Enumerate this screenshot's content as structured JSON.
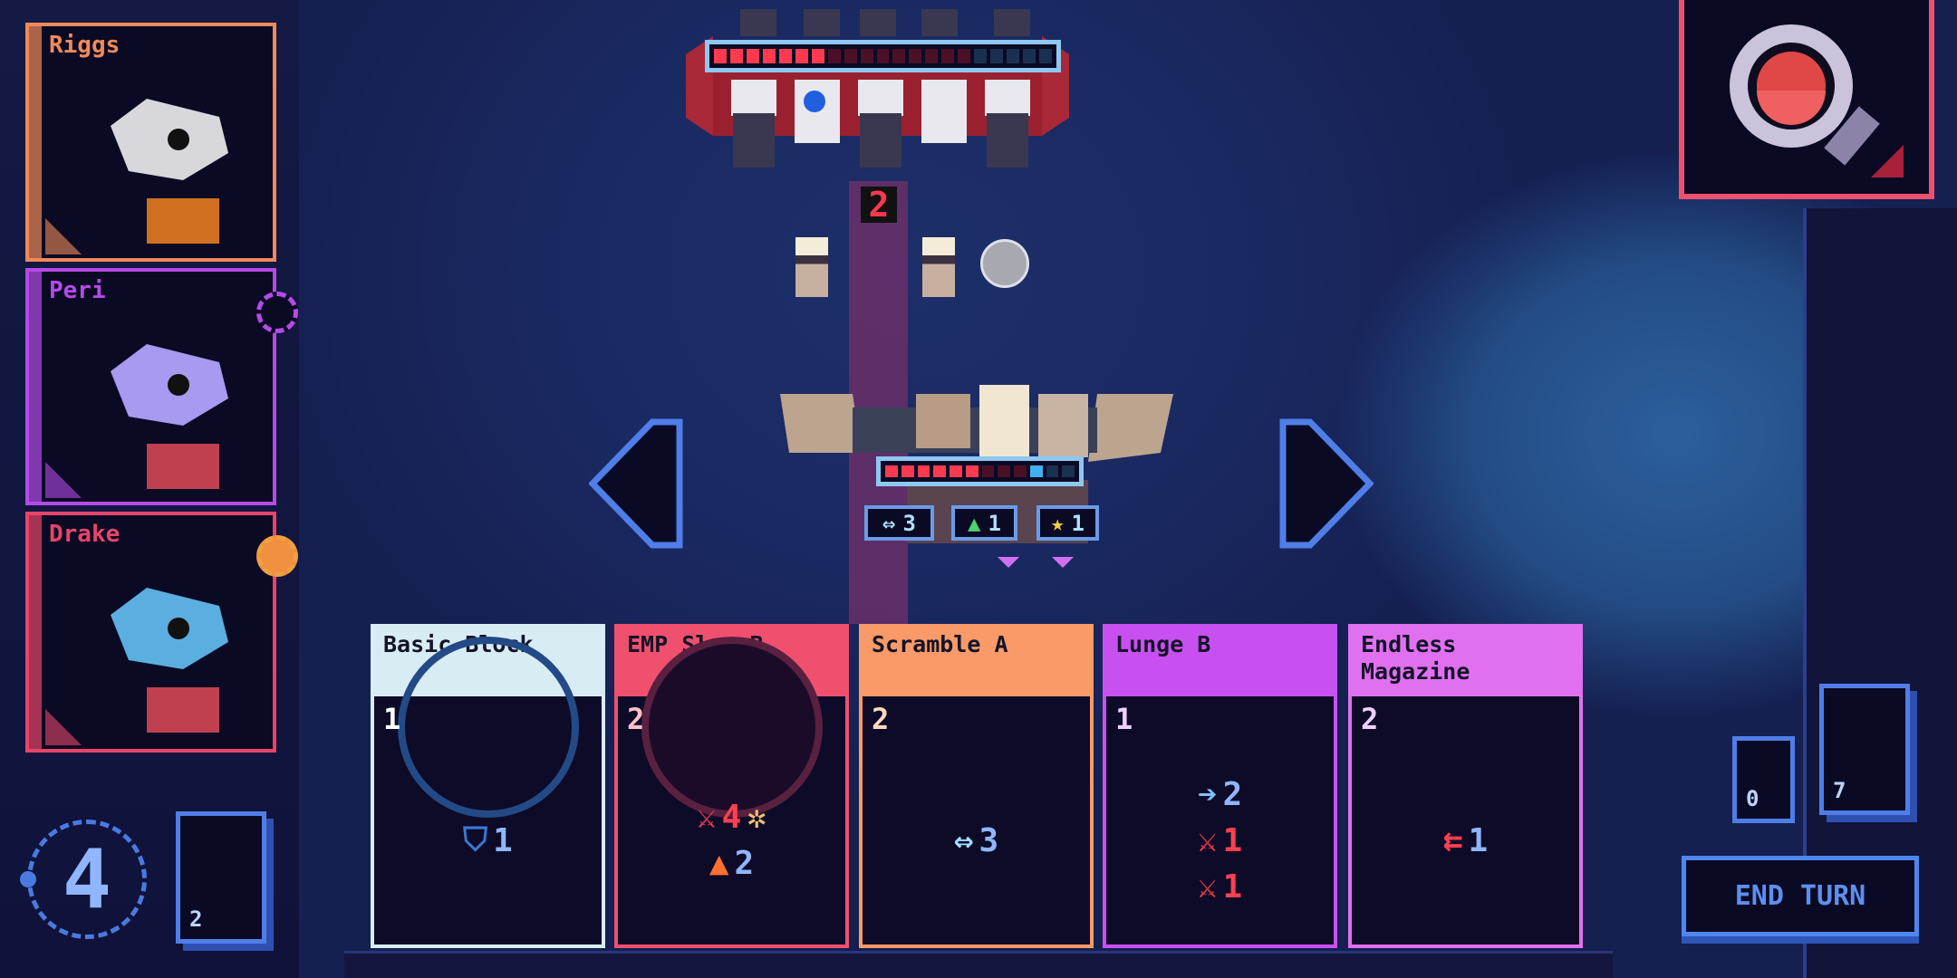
{
  "crew": [
    {
      "name": "Riggs",
      "color": "#f08a5a",
      "status_icon": "none"
    },
    {
      "name": "Peri",
      "color": "#b44ae8",
      "status_icon": "timer-icon"
    },
    {
      "name": "Drake",
      "color": "#e8446a",
      "status_icon": "battery-icon"
    }
  ],
  "energy": "4",
  "draw_pile": {
    "count": "2"
  },
  "discard_pile": {
    "count": "0"
  },
  "exhaust_pile": {
    "count": "7"
  },
  "end_turn_label": "END TURN",
  "enemy": {
    "hull_filled": 7,
    "hull_max": 16,
    "shield_max": 5,
    "shield_filled": 0,
    "intent_damage": "2",
    "portrait": "robot-eye"
  },
  "player": {
    "hull_filled": 6,
    "hull_max": 9,
    "shield_max": 3,
    "shield_filled": 1,
    "statuses": [
      {
        "icon": "evade-icon",
        "value": "3"
      },
      {
        "icon": "drone-icon",
        "value": "1"
      },
      {
        "icon": "star-icon",
        "value": "1"
      }
    ]
  },
  "hand": [
    {
      "title": "Basic Block",
      "cost": "1",
      "color": "#d8ecf4",
      "cost_color": "#ffffff",
      "effects": [
        {
          "icon": "shield-icon",
          "value": "1",
          "icon_color": "#3a78d8"
        }
      ]
    },
    {
      "title": "EMP Slug B",
      "cost": "2",
      "color": "#f0506e",
      "cost_color": "#ffc0c8",
      "effects": [
        {
          "icon": "attack-icon",
          "value": "4",
          "icon_color": "#ff4050",
          "extra": "stun-icon"
        },
        {
          "icon": "heat-icon",
          "value": "2",
          "icon_color": "#ff7030"
        }
      ]
    },
    {
      "title": "Scramble A",
      "cost": "2",
      "color": "#fa9a68",
      "cost_color": "#ffd8c0",
      "effects": [
        {
          "icon": "evade-icon",
          "value": "3",
          "icon_color": "#a0e0ff"
        }
      ]
    },
    {
      "title": "Lunge B",
      "cost": "1",
      "color": "#c850f0",
      "cost_color": "#f0d0ff",
      "effects": [
        {
          "icon": "move-icon",
          "value": "2",
          "icon_color": "#80c0ff"
        },
        {
          "icon": "attack-icon",
          "value": "1",
          "icon_color": "#ff4050"
        },
        {
          "icon": "attack-icon",
          "value": "1",
          "icon_color": "#ff4050"
        }
      ]
    },
    {
      "title": "Endless Magazine",
      "cost": "2",
      "color": "#e070f0",
      "cost_color": "#f0d0ff",
      "effects": [
        {
          "icon": "endless-icon",
          "value": "1",
          "icon_color": "#ff4050"
        }
      ]
    }
  ]
}
